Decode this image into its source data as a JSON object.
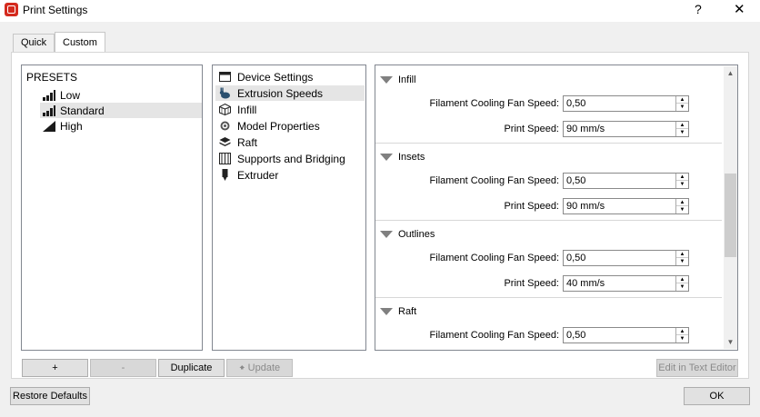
{
  "window": {
    "title": "Print Settings",
    "help_glyph": "?",
    "close_glyph": "✕"
  },
  "tabs": [
    {
      "label": "Quick"
    },
    {
      "label": "Custom"
    }
  ],
  "presets": {
    "header": "PRESETS",
    "items": [
      {
        "label": "Low"
      },
      {
        "label": "Standard"
      },
      {
        "label": "High"
      }
    ]
  },
  "categories": [
    {
      "label": "Device Settings",
      "icon": "window-icon"
    },
    {
      "label": "Extrusion Speeds",
      "icon": "rabbit-icon"
    },
    {
      "label": "Infill",
      "icon": "cube-icon"
    },
    {
      "label": "Model Properties",
      "icon": "gear-icon"
    },
    {
      "label": "Raft",
      "icon": "layers-icon"
    },
    {
      "label": "Supports and Bridging",
      "icon": "supports-icon"
    },
    {
      "label": "Extruder",
      "icon": "extruder-icon"
    }
  ],
  "sections": [
    {
      "title": "Infill",
      "fan_label": "Filament Cooling Fan Speed:",
      "fan_value": "0,50",
      "speed_label": "Print Speed:",
      "speed_value": "90 mm/s"
    },
    {
      "title": "Insets",
      "fan_label": "Filament Cooling Fan Speed:",
      "fan_value": "0,50",
      "speed_label": "Print Speed:",
      "speed_value": "90 mm/s"
    },
    {
      "title": "Outlines",
      "fan_label": "Filament Cooling Fan Speed:",
      "fan_value": "0,50",
      "speed_label": "Print Speed:",
      "speed_value": "40 mm/s"
    },
    {
      "title": "Raft",
      "fan_label": "Filament Cooling Fan Speed:",
      "fan_value": "0,50"
    }
  ],
  "buttons": {
    "add": "+",
    "remove": "-",
    "duplicate": "Duplicate",
    "update": "Update",
    "edit_text": "Edit in Text Editor",
    "restore": "Restore Defaults",
    "ok": "OK"
  }
}
